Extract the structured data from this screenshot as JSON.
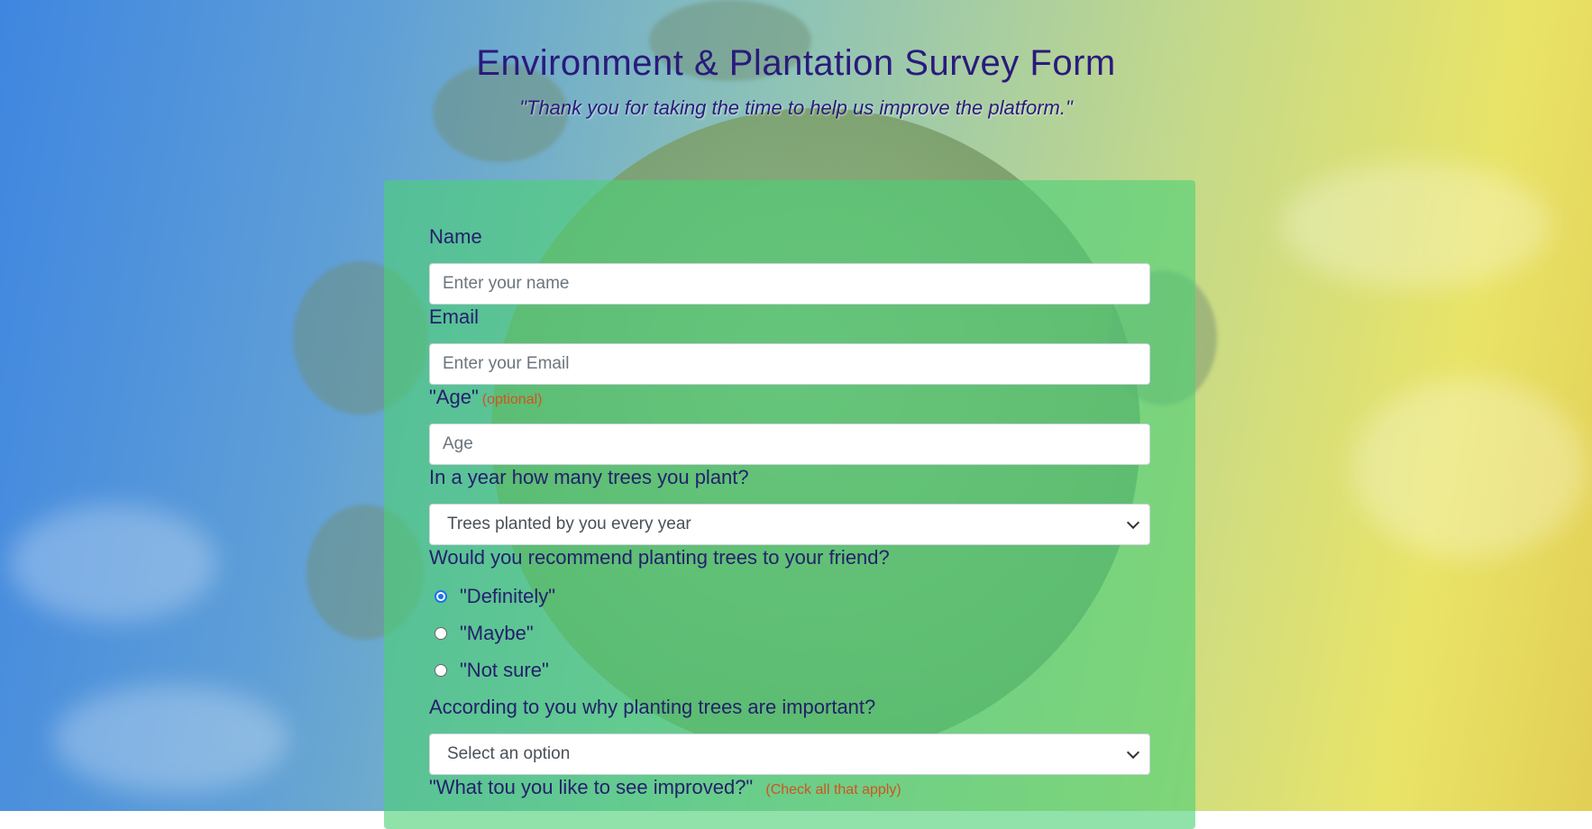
{
  "header": {
    "title": "Environment & Plantation Survey Form",
    "subtitle": "\"Thank you for taking the time to help us improve the platform.\""
  },
  "form": {
    "name": {
      "label": "Name",
      "placeholder": "Enter your name"
    },
    "email": {
      "label": "Email",
      "placeholder": "Enter your Email"
    },
    "age": {
      "label": "\"Age\"",
      "hint": "(optional)",
      "placeholder": "Age"
    },
    "trees": {
      "label": "In a year how many trees you plant?",
      "selected": "Trees planted by you every year"
    },
    "recommend": {
      "label": "Would you recommend planting trees to your friend?",
      "options": [
        "\"Definitely\"",
        "\"Maybe\"",
        "\"Not sure\""
      ],
      "checked_index": 0
    },
    "importance": {
      "label": "According to you why planting trees are important?",
      "selected": "Select an option"
    },
    "improve": {
      "label": "\"What tou you like to see improved?\"",
      "hint": "(Check all that apply)"
    }
  },
  "colors": {
    "heading": "#2a1a7c",
    "label": "#24206b",
    "hint": "#d2531e",
    "card": "#4cd076",
    "radio_checked": "#1a73e8"
  }
}
